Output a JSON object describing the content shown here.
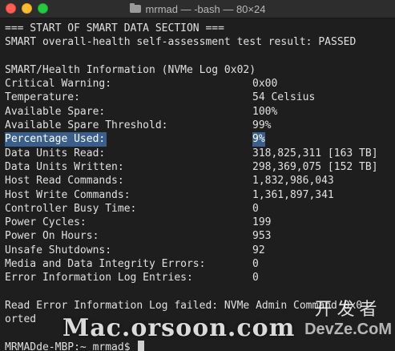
{
  "window": {
    "title": "mrmad — -bash — 80×24"
  },
  "terminal": {
    "header1": "=== START OF SMART DATA SECTION ===",
    "header2": "SMART overall-health self-assessment test result: PASSED",
    "section": "SMART/Health Information (NVMe Log 0x02)",
    "rows": [
      {
        "key": "Critical Warning:",
        "value": "0x00"
      },
      {
        "key": "Temperature:",
        "value": "54 Celsius"
      },
      {
        "key": "Available Spare:",
        "value": "100%"
      },
      {
        "key": "Available Spare Threshold:",
        "value": "99%"
      },
      {
        "key": "Percentage Used:",
        "value": "9%"
      },
      {
        "key": "Data Units Read:",
        "value": "318,825,311 [163 TB]"
      },
      {
        "key": "Data Units Written:",
        "value": "298,369,075 [152 TB]"
      },
      {
        "key": "Host Read Commands:",
        "value": "1,832,986,043"
      },
      {
        "key": "Host Write Commands:",
        "value": "1,361,897,341"
      },
      {
        "key": "Controller Busy Time:",
        "value": "0"
      },
      {
        "key": "Power Cycles:",
        "value": "199"
      },
      {
        "key": "Power On Hours:",
        "value": "953"
      },
      {
        "key": "Unsafe Shutdowns:",
        "value": "92"
      },
      {
        "key": "Media and Data Integrity Errors:",
        "value": "0"
      },
      {
        "key": "Error Information Log Entries:",
        "value": "0"
      }
    ],
    "error_line1": "Read Error Information Log failed: NVMe Admin Command 0x0",
    "error_line2": "orted",
    "prompt": "MRMADde-MBP:~ mrmad$"
  },
  "watermark": {
    "text": "Mac.orsoon.com",
    "logo_cn": "开发者",
    "logo_en": "DevZe.CoM"
  }
}
